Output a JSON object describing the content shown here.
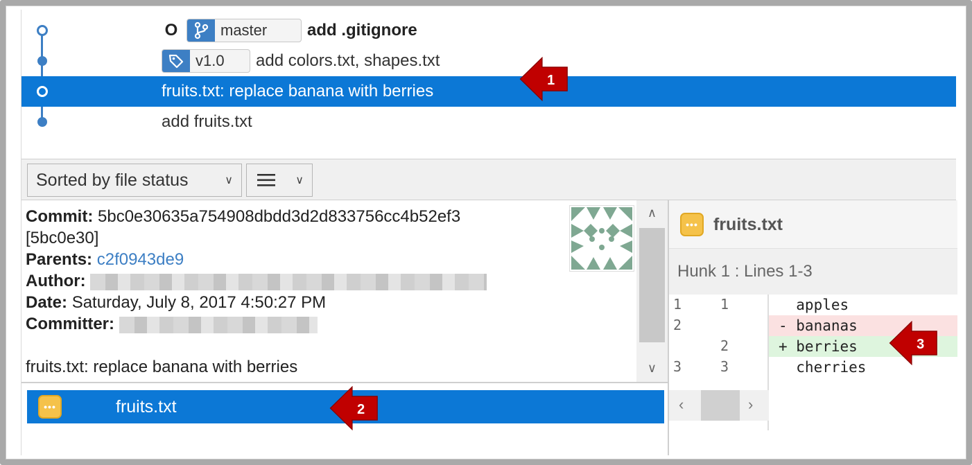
{
  "commits": [
    {
      "head_marker": "O",
      "branch": "master",
      "message": "add .gitignore",
      "bold": true
    },
    {
      "tag": "v1.0",
      "message": "add colors.txt, shapes.txt"
    },
    {
      "message": "fruits.txt: replace banana with berries",
      "selected": true
    },
    {
      "message": "add fruits.txt"
    }
  ],
  "toolbar": {
    "sort_label": "Sorted by file status",
    "view_icon": "list-icon"
  },
  "details": {
    "commit_label": "Commit:",
    "commit_hash": "5bc0e30635a754908dbdd3d2d833756cc4b52ef3",
    "short_hash": "[5bc0e30]",
    "parents_label": "Parents:",
    "parent_hash": "c2f0943de9",
    "author_label": "Author:",
    "date_label": "Date:",
    "date_value": "Saturday, July 8, 2017 4:50:27 PM",
    "committer_label": "Committer:",
    "message": "fruits.txt: replace banana with berries"
  },
  "files": [
    {
      "name": "fruits.txt",
      "status_icon": "modified-icon"
    }
  ],
  "diff": {
    "file": "fruits.txt",
    "hunk_header": "Hunk 1 : Lines 1-3",
    "lines": [
      {
        "old": "1",
        "new": "1",
        "text": "  apples",
        "type": "ctx"
      },
      {
        "old": "2",
        "new": "",
        "text": "- bananas",
        "type": "del"
      },
      {
        "old": "",
        "new": "2",
        "text": "+ berries",
        "type": "add"
      },
      {
        "old": "3",
        "new": "3",
        "text": "  cherries",
        "type": "ctx"
      }
    ]
  },
  "callouts": [
    "1",
    "2",
    "3"
  ],
  "colors": {
    "selection": "#0c78d6",
    "graph": "#3d7fc4",
    "callout": "#c00000",
    "deleted_bg": "#fbe1e1",
    "added_bg": "#def5de"
  }
}
